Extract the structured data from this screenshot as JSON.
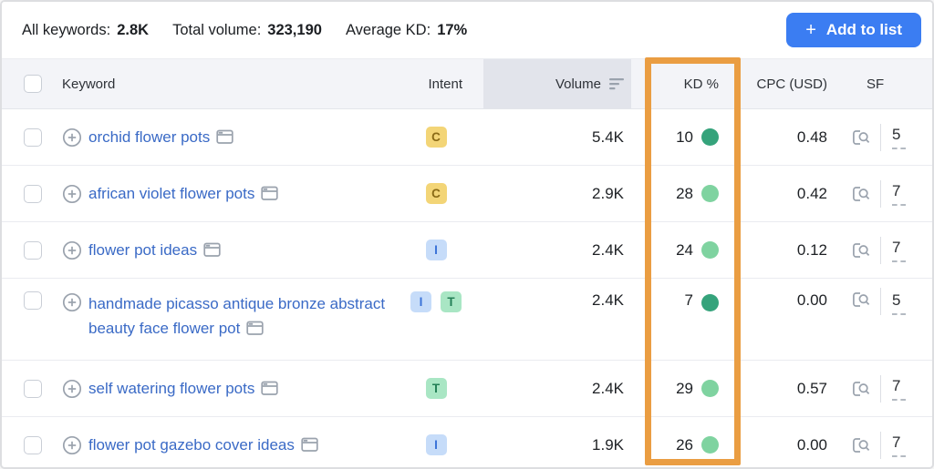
{
  "summary": {
    "items": [
      {
        "label": "All keywords:",
        "value": "2.8K"
      },
      {
        "label": "Total volume:",
        "value": "323,190"
      },
      {
        "label": "Average KD:",
        "value": "17%"
      }
    ]
  },
  "toolbar": {
    "add_to_list": {
      "icon": "+",
      "label": "Add to list"
    }
  },
  "table": {
    "header": {
      "keyword": "Keyword",
      "intent": "Intent",
      "volume": "Volume",
      "kd": "KD %",
      "cpc": "CPC (USD)",
      "sf": "SF"
    },
    "sorted_column": "Volume",
    "rows": [
      {
        "keyword": "orchid flower pots",
        "intents": [
          {
            "code": "C",
            "type": "commercial"
          }
        ],
        "volume": "5.4K",
        "kd": "10",
        "kd_level": "very-easy",
        "cpc": "0.48",
        "sf": "5"
      },
      {
        "keyword": "african violet flower pots",
        "intents": [
          {
            "code": "C",
            "type": "commercial"
          }
        ],
        "volume": "2.9K",
        "kd": "28",
        "kd_level": "easy",
        "cpc": "0.42",
        "sf": "7"
      },
      {
        "keyword": "flower pot ideas",
        "intents": [
          {
            "code": "I",
            "type": "informational"
          }
        ],
        "volume": "2.4K",
        "kd": "24",
        "kd_level": "easy",
        "cpc": "0.12",
        "sf": "7"
      },
      {
        "keyword": "handmade picasso antique bronze abstract beauty face flower pot",
        "intents": [
          {
            "code": "I",
            "type": "informational"
          },
          {
            "code": "T",
            "type": "transactional"
          }
        ],
        "volume": "2.4K",
        "kd": "7",
        "kd_level": "very-easy",
        "cpc": "0.00",
        "sf": "5"
      },
      {
        "keyword": "self watering flower pots",
        "intents": [
          {
            "code": "T",
            "type": "transactional"
          }
        ],
        "volume": "2.4K",
        "kd": "29",
        "kd_level": "easy",
        "cpc": "0.57",
        "sf": "7"
      },
      {
        "keyword": "flower pot gazebo cover ideas",
        "intents": [
          {
            "code": "I",
            "type": "informational"
          }
        ],
        "volume": "1.9K",
        "kd": "26",
        "kd_level": "easy",
        "cpc": "0.00",
        "sf": "7"
      }
    ]
  },
  "colors": {
    "annotation_orange": "#EA9D42",
    "button_blue": "#3B7DF2",
    "link_blue": "#3A6AC6",
    "kd_dot_very_easy": "#35A37B",
    "kd_dot_easy": "#7FD3A0",
    "intent_c_bg": "#F3D577",
    "intent_i_bg": "#C6DCF9",
    "intent_t_bg": "#A9E6C4",
    "header_bg": "#F3F4F8",
    "sorted_header_bg": "#E2E4EB"
  }
}
